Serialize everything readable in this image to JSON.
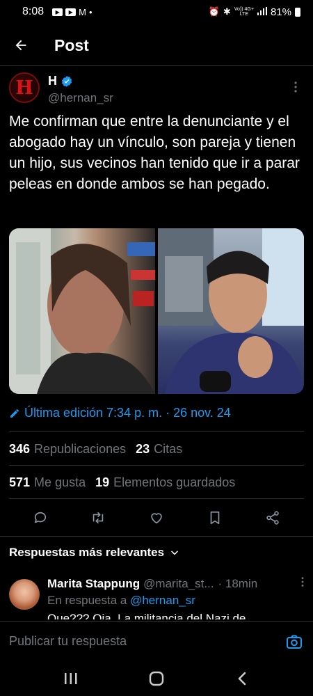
{
  "status_bar": {
    "time": "8:08",
    "network_top": "Vo)) 4G+",
    "network_bottom": "LTE",
    "battery": "81%"
  },
  "header": {
    "title": "Post",
    "back_icon": "arrow-left-icon"
  },
  "post": {
    "author_name": "H",
    "author_handle": "@hernan_sr",
    "avatar_letter": "H",
    "verified": true,
    "text": "Me confirman que entre la denunciante y el abogado hay un vínculo, son pareja y tienen un hijo, sus vecinos han tenido que ir a parar peleas en donde ambos se han pegado.",
    "edited_label": "Última edición 7:34 p. m. · 26 nov. 24",
    "stats": {
      "reposts_count": "346",
      "reposts_label": "Republicaciones",
      "quotes_count": "23",
      "quotes_label": "Citas",
      "likes_count": "571",
      "likes_label": "Me gusta",
      "bookmarks_count": "19",
      "bookmarks_label": "Elementos guardados"
    }
  },
  "replies": {
    "sort_label": "Respuestas más relevantes",
    "items": [
      {
        "name": "Marita Stappung",
        "handle": "@marita_st...",
        "time": "· 18min",
        "in_reply_prefix": "En respuesta a",
        "in_reply_handle": "@hernan_sr",
        "text": "Que??? Oia. La militancia del Nazi de"
      }
    ]
  },
  "composer": {
    "placeholder": "Publicar tu respuesta"
  },
  "colors": {
    "accent": "#1d9bf0",
    "background": "#000000",
    "muted": "#71767b",
    "divider": "#2f3336"
  }
}
